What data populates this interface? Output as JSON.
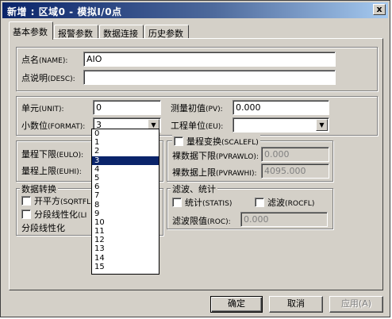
{
  "window": {
    "title": "新增 : 区域0 - 模拟I/0点",
    "close_symbol": "x"
  },
  "tabs": [
    {
      "label": "基本参数",
      "active": true
    },
    {
      "label": "报警参数",
      "active": false
    },
    {
      "label": "数据连接",
      "active": false
    },
    {
      "label": "历史参数",
      "active": false
    }
  ],
  "basic": {
    "name_label": "点名",
    "name_code": "(NAME):",
    "name_value": "AIO",
    "desc_label": "点说明",
    "desc_code": "(DESC):",
    "desc_value": ""
  },
  "unit": {
    "unit_label": "单元",
    "unit_code": "(UNIT):",
    "unit_value": "0",
    "format_label": "小数位",
    "format_code": "(FORMAT):",
    "format_value": "3",
    "pv_label": "测量初值",
    "pv_code": "(PV):",
    "pv_value": "0.000",
    "eu_label": "工程单位",
    "eu_code": "(EU):",
    "eu_value": ""
  },
  "range": {
    "eulo_label": "量程下限",
    "eulo_code": "(EULO):",
    "euhi_label": "量程上限",
    "euhi_code": "(EUHI):",
    "scale_label": "量程变换",
    "scale_code": "(SCALEFL)",
    "pvrawlo_label": "裸数据下限",
    "pvrawlo_code": "(PVRAWLO):",
    "pvrawlo_value": "0.000",
    "pvrawhi_label": "裸数据上限",
    "pvrawhi_code": "(PVRAWHI):",
    "pvrawhi_value": "4095.000"
  },
  "conversion": {
    "group_label": "数据转换",
    "sqrt_label": "开平方",
    "sqrt_code": "(SQRTFL",
    "linear_label": "分段线性化",
    "linear_code": "(LI",
    "linear_text": "分段线性化"
  },
  "filter": {
    "group_label": "滤波、统计",
    "stats_label": "统计",
    "stats_code": "(STATIS)",
    "rocfl_label": "滤波",
    "rocfl_code": "(ROCFL)",
    "roc_label": "滤波限值",
    "roc_code": "(ROC):",
    "roc_value": "0.000"
  },
  "format_options": [
    "0",
    "1",
    "2",
    "3",
    "4",
    "5",
    "6",
    "7",
    "8",
    "9",
    "10",
    "11",
    "12",
    "13",
    "14",
    "15"
  ],
  "format_selected_index": 3,
  "buttons": {
    "ok": "确定",
    "cancel": "取消",
    "apply": "应用(A)"
  }
}
